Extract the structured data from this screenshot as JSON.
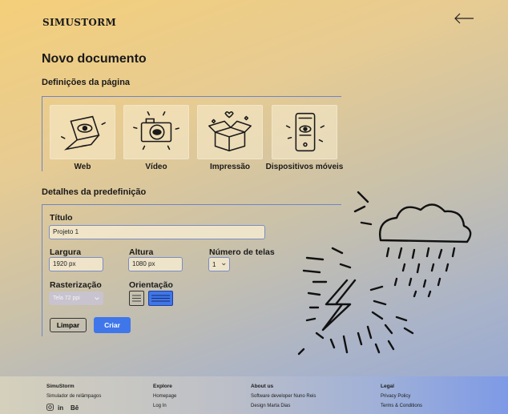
{
  "brand": "SIMUSTORM",
  "page_title": "Novo documento",
  "sections": {
    "page_settings": "Definições da página",
    "preset_details": "Detalhes da predefinição"
  },
  "cards": [
    {
      "label": "Web",
      "icon": "laptop-eye-icon"
    },
    {
      "label": "Vídeo",
      "icon": "camera-eye-icon"
    },
    {
      "label": "Impressão",
      "icon": "box-hearts-icon"
    },
    {
      "label": "Dispositivos móveis",
      "icon": "phone-eye-icon"
    }
  ],
  "form": {
    "title_label": "Título",
    "title_value": "Projeto 1",
    "width_label": "Largura",
    "width_value": "1920 px",
    "height_label": "Altura",
    "height_value": "1080 px",
    "screens_label": "Número de telas",
    "screens_value": "1",
    "raster_label": "Rasterização",
    "raster_value": "Tela 72 ppi",
    "orientation_label": "Orientação",
    "orientation_options": [
      "portrait",
      "landscape"
    ],
    "orientation_selected": "landscape"
  },
  "buttons": {
    "clear": "Limpar",
    "create": "Criar"
  },
  "colors": {
    "accent": "#3f76ea",
    "frame": "#6f86c6"
  },
  "footer": {
    "col1": {
      "head": "SimuStorm",
      "lines": [
        "Simulador de relâmpagos"
      ],
      "social": [
        "instagram-icon",
        "linkedin-icon",
        "behance-icon"
      ]
    },
    "col2": {
      "head": "Explore",
      "lines": [
        "Homepage",
        "Log In"
      ]
    },
    "col3": {
      "head": "About us",
      "lines": [
        "Software developer Nuno Reis",
        "Design Marta Dias"
      ]
    },
    "col4": {
      "head": "Legal",
      "lines": [
        "Privacy Policy",
        "Terms & Conditions"
      ]
    }
  }
}
